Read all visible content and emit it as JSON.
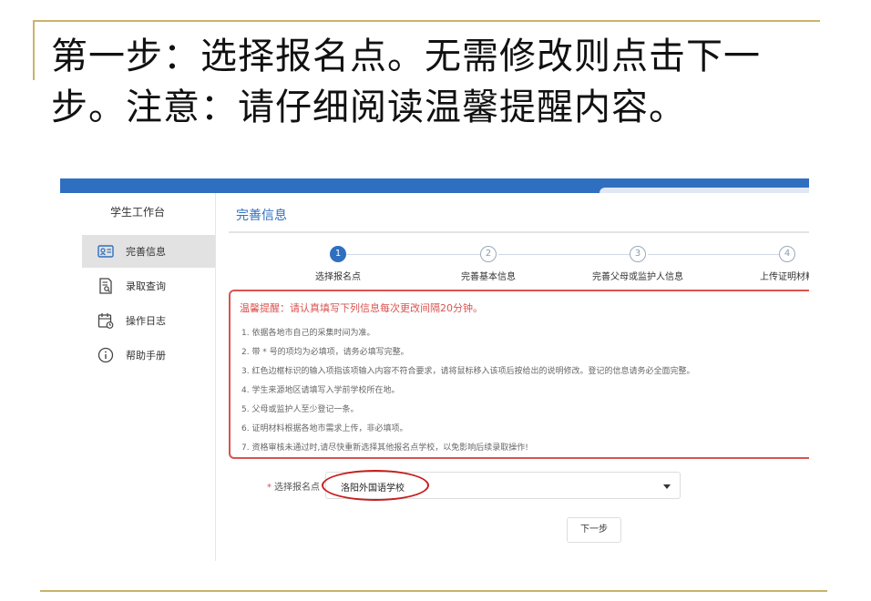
{
  "slide": {
    "title": "第一步：选择报名点。无需修改则点击下一步。注意：请仔细阅读温馨提醒内容。"
  },
  "sidebar": {
    "title": "学生工作台",
    "items": [
      {
        "label": "完善信息",
        "icon": "id-card-icon",
        "active": true
      },
      {
        "label": "录取查询",
        "icon": "search-document-icon",
        "active": false
      },
      {
        "label": "操作日志",
        "icon": "calendar-log-icon",
        "active": false
      },
      {
        "label": "帮助手册",
        "icon": "info-circle-icon",
        "active": false
      }
    ]
  },
  "main": {
    "title": "完善信息"
  },
  "steps": [
    {
      "number": "1",
      "label": "选择报名点",
      "state": "current"
    },
    {
      "number": "2",
      "label": "完善基本信息",
      "state": "todo"
    },
    {
      "number": "3",
      "label": "完善父母或监护人信息",
      "state": "todo"
    },
    {
      "number": "4",
      "label": "上传证明材料",
      "state": "todo"
    }
  ],
  "notice": {
    "heading": "温馨提醒：请认真填写下列信息每次更改间隔20分钟。",
    "items": [
      "1. 依据各地市自己的采集时间为准。",
      "2. 带 * 号的项均为必填项，请务必填写完整。",
      "3. 红色边框标识的输入项指该项输入内容不符合要求，请将鼠标移入该项后按给出的说明修改。登记的信息请务必全面完整。",
      "4. 学生来源地区请填写入学前学校所在地。",
      "5. 父母或监护人至少登记一条。",
      "6. 证明材料根据各地市需求上传，非必填项。",
      "7. 资格审核未通过时,请尽快重新选择其他报名点学校，以免影响后续录取操作!"
    ]
  },
  "form": {
    "required_mark": "*",
    "label": "选择报名点",
    "selected_value": "洛阳外国语学校"
  },
  "buttons": {
    "next_label": "下一步"
  },
  "colors": {
    "brand_blue": "#2f6fc0",
    "alert_red": "#d9534f",
    "slide_rule_gold": "#c8b36a"
  }
}
